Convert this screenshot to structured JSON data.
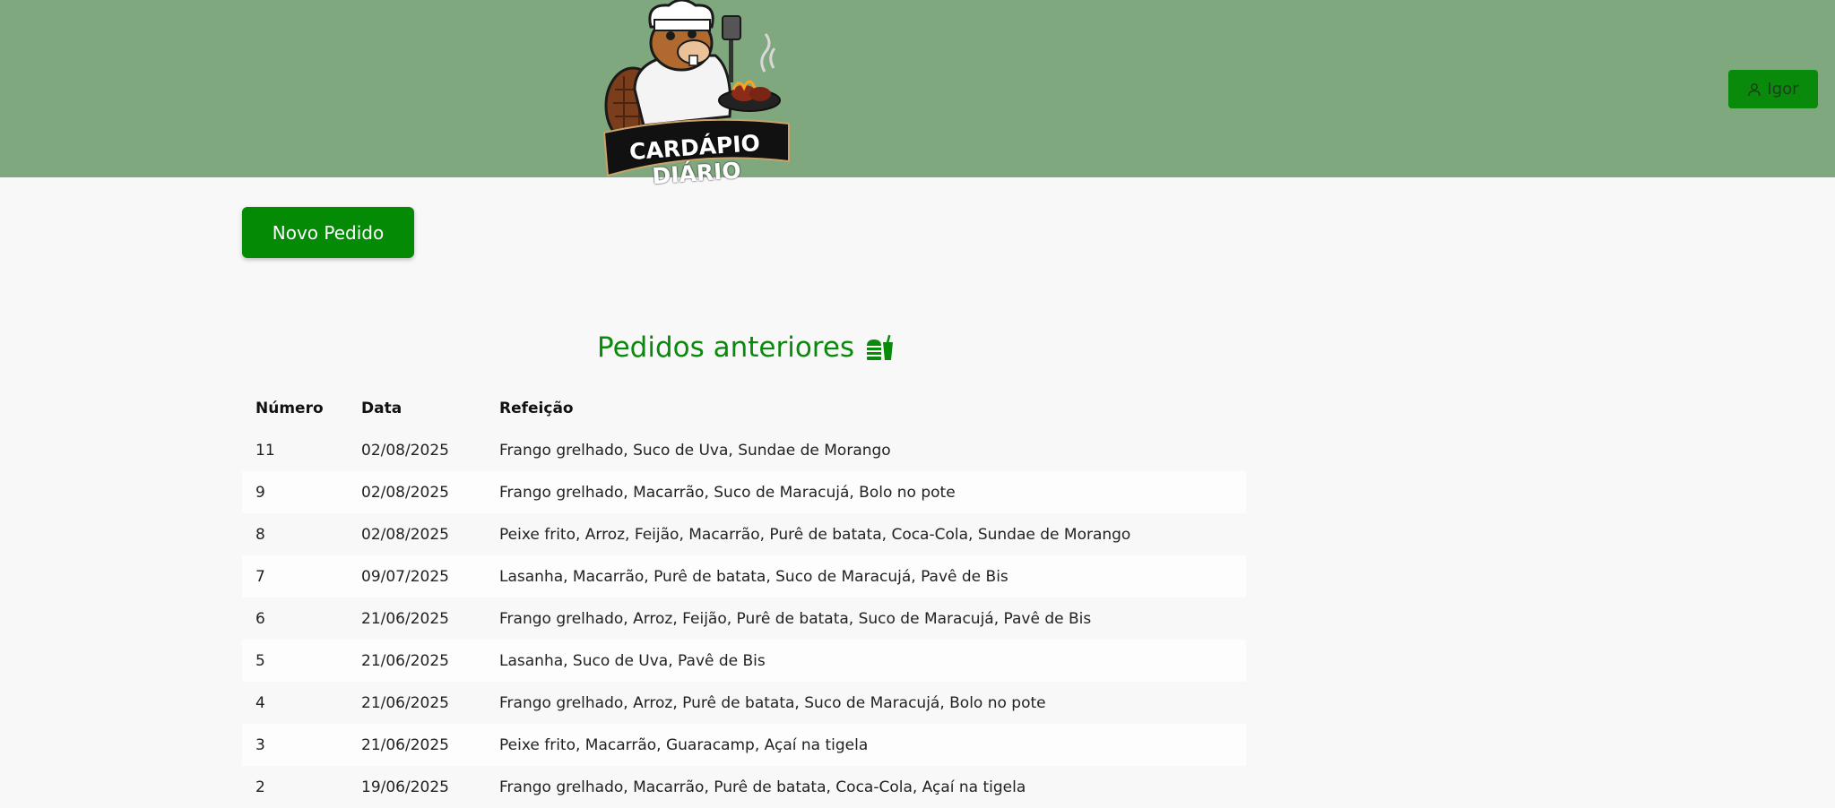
{
  "header": {
    "logo_text": "CARDÁPIO DIÁRIO",
    "user_label": "Igor",
    "background": "#7fa87f"
  },
  "actions": {
    "new_order_label": "Novo Pedido",
    "accent": "#058a05"
  },
  "orders": {
    "title": "Pedidos anteriores",
    "title_icon": "burger-drink-icon",
    "columns": [
      "Número",
      "Data",
      "Refeição"
    ],
    "rows": [
      {
        "numero": "11",
        "data": "02/08/2025",
        "refeicao": "Frango grelhado, Suco de Uva, Sundae de Morango"
      },
      {
        "numero": "9",
        "data": "02/08/2025",
        "refeicao": "Frango grelhado, Macarrão, Suco de Maracujá, Bolo no pote"
      },
      {
        "numero": "8",
        "data": "02/08/2025",
        "refeicao": "Peixe frito, Arroz, Feijão, Macarrão, Purê de batata, Coca-Cola, Sundae de Morango"
      },
      {
        "numero": "7",
        "data": "09/07/2025",
        "refeicao": "Lasanha, Macarrão, Purê de batata, Suco de Maracujá, Pavê de Bis"
      },
      {
        "numero": "6",
        "data": "21/06/2025",
        "refeicao": "Frango grelhado, Arroz, Feijão, Purê de batata, Suco de Maracujá, Pavê de Bis"
      },
      {
        "numero": "5",
        "data": "21/06/2025",
        "refeicao": "Lasanha, Suco de Uva, Pavê de Bis"
      },
      {
        "numero": "4",
        "data": "21/06/2025",
        "refeicao": "Frango grelhado, Arroz, Purê de batata, Suco de Maracujá, Bolo no pote"
      },
      {
        "numero": "3",
        "data": "21/06/2025",
        "refeicao": "Peixe frito, Macarrão, Guaracamp, Açaí na tigela"
      },
      {
        "numero": "2",
        "data": "19/06/2025",
        "refeicao": "Frango grelhado, Macarrão, Purê de batata, Coca-Cola, Açaí na tigela"
      }
    ]
  }
}
